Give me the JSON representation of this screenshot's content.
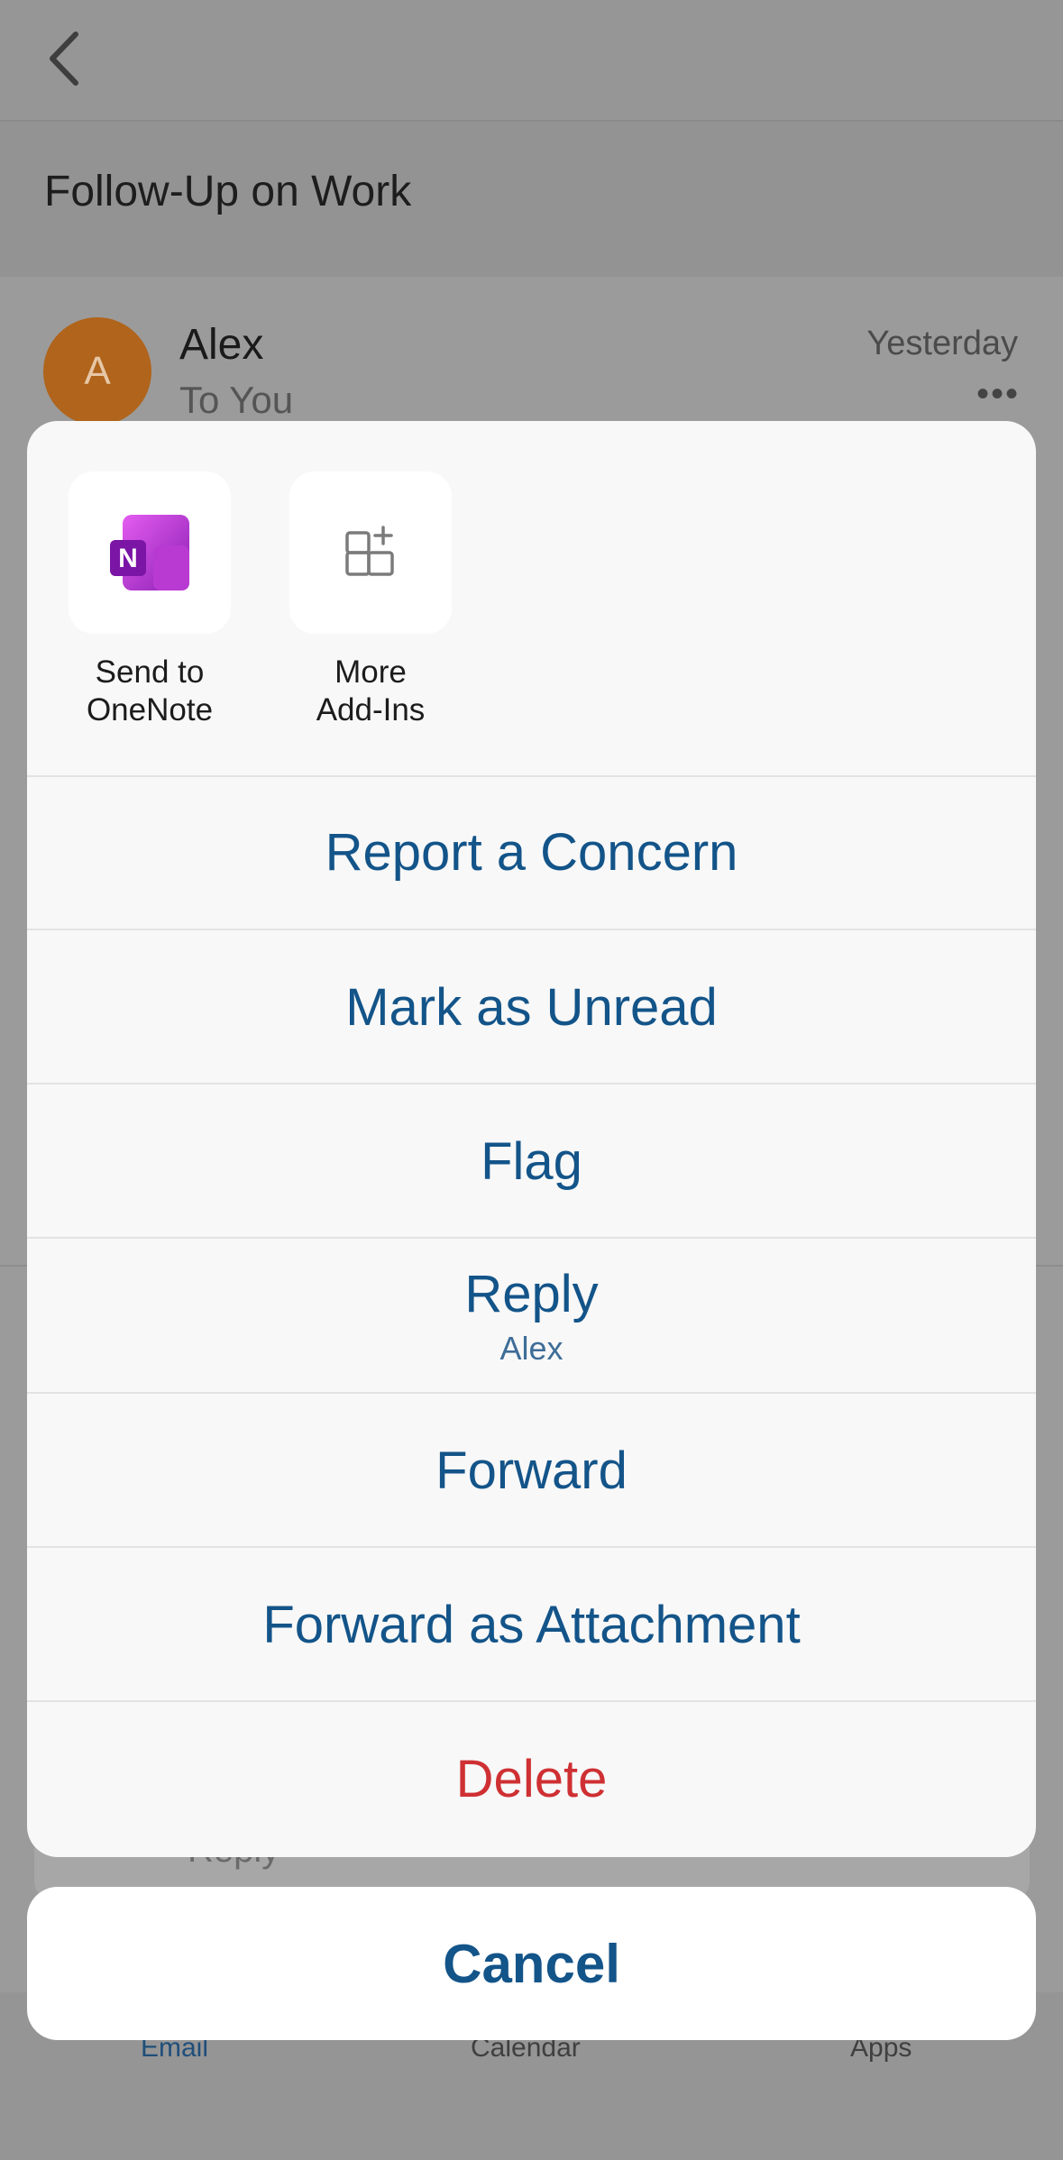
{
  "email": {
    "subject": "Follow-Up on Work",
    "avatar_initial": "A",
    "sender": "Alex",
    "recipient": "To You",
    "date": "Yesterday",
    "more_glyph": "•••"
  },
  "reply_bar": {
    "placeholder": "Reply"
  },
  "tabs": [
    {
      "label": "Email",
      "active": true
    },
    {
      "label": "Calendar",
      "active": false
    },
    {
      "label": "Apps",
      "active": false
    }
  ],
  "sheet": {
    "addins": [
      {
        "label": "Send to OneNote",
        "line1": "Send to",
        "line2": "OneNote",
        "icon": "onenote-icon"
      },
      {
        "label": "More Add-Ins",
        "line1": "More",
        "line2": "Add-Ins",
        "icon": "add-ins-icon"
      }
    ],
    "actions": [
      {
        "label": "Report a Concern"
      },
      {
        "label": "Mark as Unread"
      },
      {
        "label": "Flag"
      },
      {
        "label": "Reply",
        "sub": "Alex"
      },
      {
        "label": "Forward"
      },
      {
        "label": "Forward as Attachment"
      },
      {
        "label": "Delete",
        "destructive": true
      }
    ],
    "cancel_label": "Cancel"
  },
  "colors": {
    "action_text": "#135489",
    "destructive": "#cf3033",
    "avatar": "#b0641c"
  }
}
